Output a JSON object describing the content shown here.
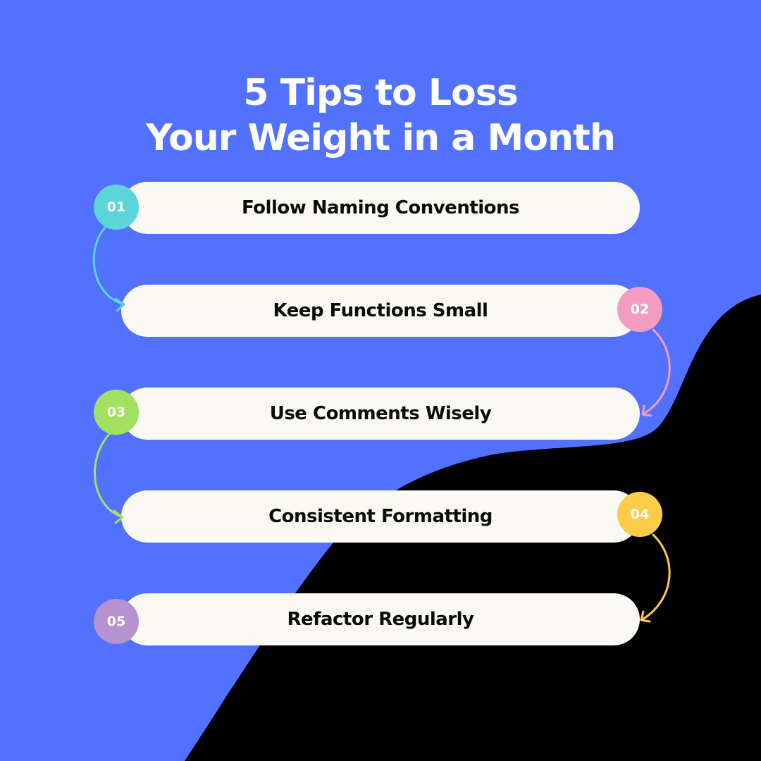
{
  "title": {
    "line1": "5 Tips to Loss",
    "line2": "Your Weight in a Month"
  },
  "colors": {
    "background": "#5271ff",
    "wave": "#000000",
    "pill": "#fbf9f3",
    "text_dark": "#0a0a0a",
    "title_text": "#ffffff"
  },
  "steps": [
    {
      "number": "01",
      "label": "Follow Naming Conventions",
      "color": "#5ad6d8"
    },
    {
      "number": "02",
      "label": "Keep Functions Small",
      "color": "#f49cc0"
    },
    {
      "number": "03",
      "label": "Use Comments Wisely",
      "color": "#a4e060"
    },
    {
      "number": "04",
      "label": "Consistent Formatting",
      "color": "#fbcd49"
    },
    {
      "number": "05",
      "label": "Refactor Regularly",
      "color": "#b692cf"
    }
  ]
}
